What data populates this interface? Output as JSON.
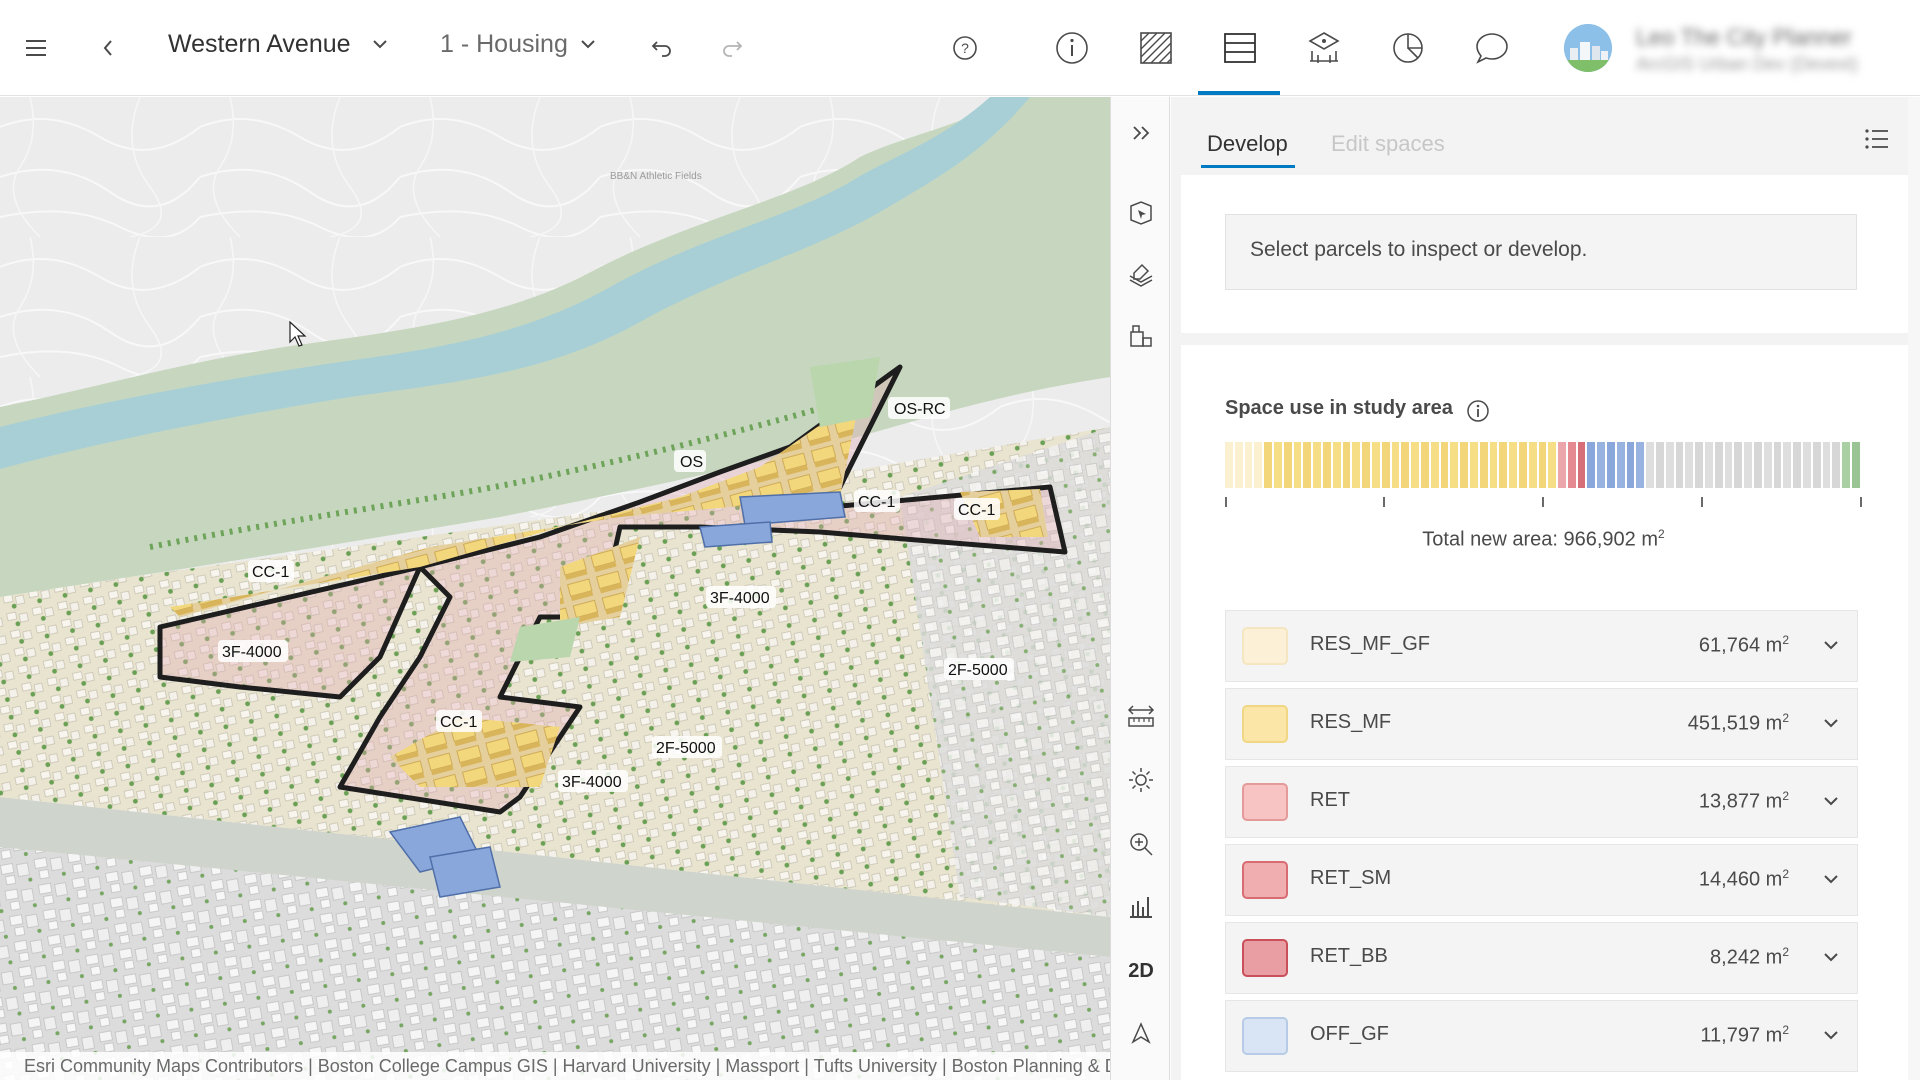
{
  "header": {
    "scenario": "Western Avenue",
    "plan": "1 - Housing",
    "user_name": "Leo The City Planner",
    "user_org": "ArcGIS Urban Dev (Devext)"
  },
  "map": {
    "zone_labels": [
      "OS-RC",
      "OS",
      "CC-1",
      "CC-1",
      "CC-1",
      "3F-4000",
      "3F-4000",
      "2F-5000",
      "CC-1",
      "2F-5000",
      "3F-4000"
    ],
    "place_label": "BB&N Athletic Fields",
    "attribution": "Esri Community Maps Contributors | Boston College Campus GIS | Harvard University | Massport | Tufts University | Boston Planning & D"
  },
  "tools": {
    "view_2d": "2D"
  },
  "panel": {
    "tabs": [
      "Develop",
      "Edit spaces"
    ],
    "notice": "Select parcels to inspect or develop.",
    "section_title": "Space use in study area",
    "total_label": "Total new area: 966,902 m",
    "total_unit_sup": "2",
    "space_uses": [
      {
        "name": "RES_MF_GF",
        "value": "61,764 m",
        "fill": "#fcf1d6",
        "border": "#f3e6c0"
      },
      {
        "name": "RES_MF",
        "value": "451,519 m",
        "fill": "#fbe6a7",
        "border": "#f0d784"
      },
      {
        "name": "RET",
        "value": "13,877 m",
        "fill": "#f7c3c3",
        "border": "#e59a9a"
      },
      {
        "name": "RET_SM",
        "value": "14,460 m",
        "fill": "#f1aeb0",
        "border": "#d96b72"
      },
      {
        "name": "RET_BB",
        "value": "8,242 m",
        "fill": "#e99ea3",
        "border": "#c9505a"
      },
      {
        "name": "OFF_GF",
        "value": "11,797 m",
        "fill": "#d9e5f5",
        "border": "#b7cbe6"
      }
    ],
    "unit_sup": "2"
  },
  "colors": {
    "accent": "#007ac2",
    "residential": "#f4d978",
    "retail": "#e48a90",
    "office": "#8aa7dc"
  }
}
